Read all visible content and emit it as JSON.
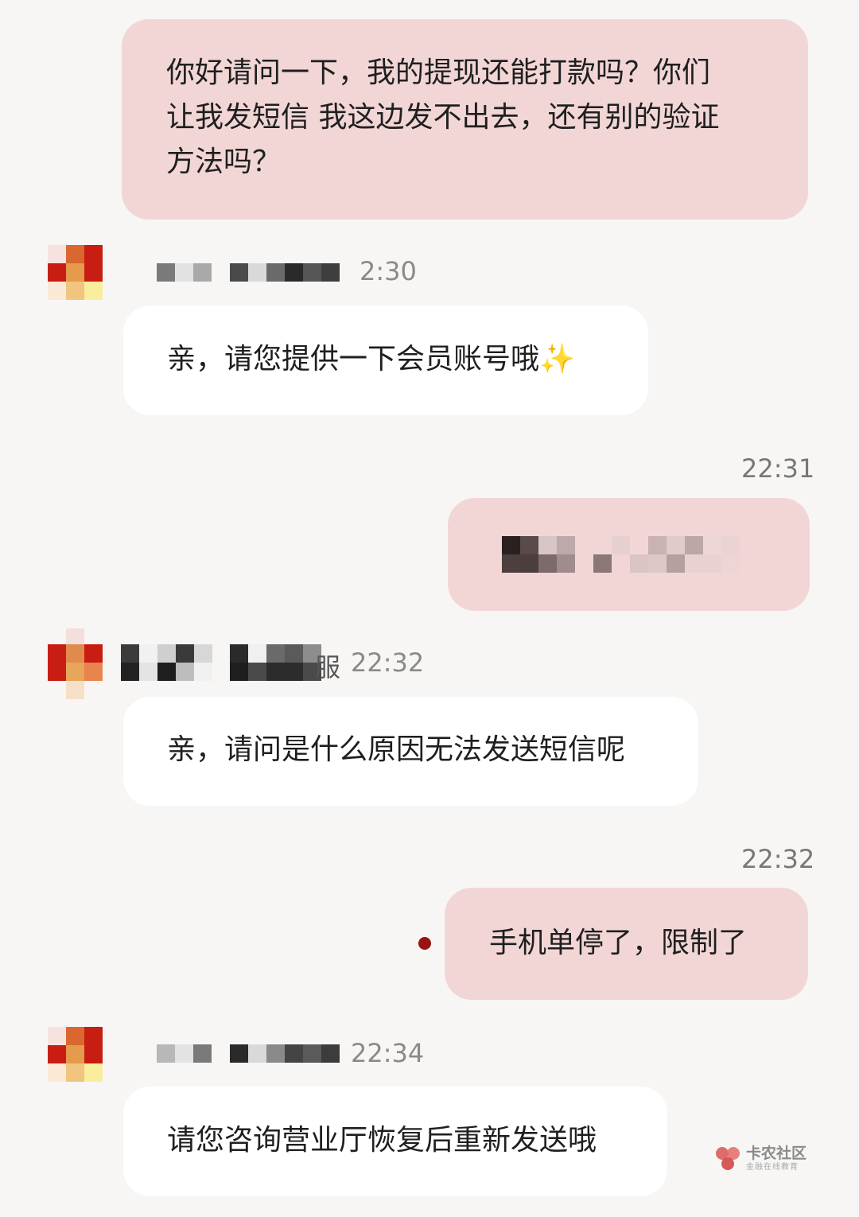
{
  "messages": [
    {
      "id": "m1",
      "direction": "out",
      "text": "你好请问一下，我的提现还能打款吗？你们\n让我发短信 我这边发不出去，还有别的验证\n方法吗？"
    },
    {
      "id": "m2",
      "direction": "in",
      "time": "2:30",
      "text": "亲，请您提供一下会员账号哦"
    },
    {
      "id": "m3",
      "direction": "out",
      "time": "22:31",
      "text": ""
    },
    {
      "id": "m4",
      "direction": "in",
      "time": "22:32",
      "sender_visible_char": "服",
      "text": "亲，请问是什么原因无法发送短信呢"
    },
    {
      "id": "m5",
      "direction": "out",
      "time": "22:32",
      "text": "手机单停了，限制了"
    },
    {
      "id": "m6",
      "direction": "in",
      "time": "22:34",
      "text": "请您咨询营业厅恢复后重新发送哦"
    }
  ],
  "emoji": {
    "sparkle": "✨"
  },
  "watermark": {
    "main": "卡农社区",
    "sub": "金融在线教育"
  },
  "colors": {
    "outgoing_bubble": "#f2d6d6",
    "incoming_bubble": "#ffffff",
    "background": "#f7f6f5",
    "timestamp": "#777777",
    "unread_dot": "#9a1212"
  },
  "icons": [
    "avatar-icon",
    "unread-dot-icon",
    "sparkle-icon",
    "watermark-logo-icon"
  ]
}
